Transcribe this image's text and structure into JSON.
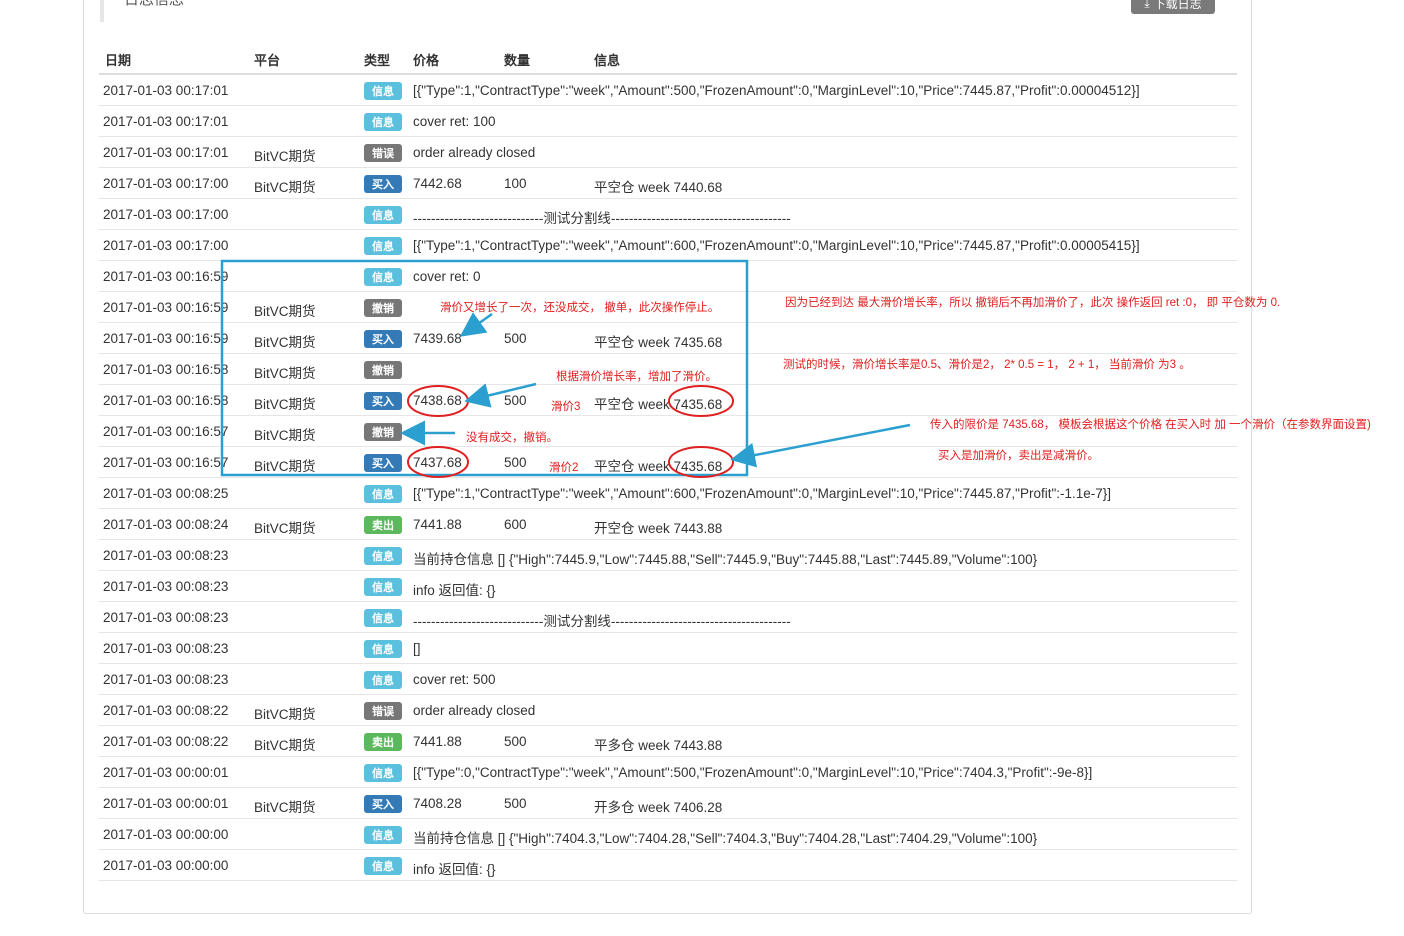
{
  "panel": {
    "title": "日志信息",
    "download_label": "下载日志"
  },
  "columns": {
    "date": "日期",
    "platform": "平台",
    "type": "类型",
    "price": "价格",
    "amount": "数量",
    "info": "信息"
  },
  "badges": {
    "info": "信息",
    "error": "错误",
    "buy": "买入",
    "sell": "卖出",
    "cancel": "撤销"
  },
  "rows": [
    {
      "date": "2017-01-03 00:17:01",
      "platform": "",
      "type": "info",
      "long": "[{\"Type\":1,\"ContractType\":\"week\",\"Amount\":500,\"FrozenAmount\":0,\"MarginLevel\":10,\"Price\":7445.87,\"Profit\":0.00004512}]"
    },
    {
      "date": "2017-01-03 00:17:01",
      "platform": "",
      "type": "info",
      "long": "cover ret: 100"
    },
    {
      "date": "2017-01-03 00:17:01",
      "platform": "BitVC期货",
      "type": "error",
      "long": "order already closed"
    },
    {
      "date": "2017-01-03 00:17:00",
      "platform": "BitVC期货",
      "type": "buy",
      "price": "7442.68",
      "amount": "100",
      "msg": "平空仓 week 7440.68"
    },
    {
      "date": "2017-01-03 00:17:00",
      "platform": "",
      "type": "info",
      "long": "-----------------------------测试分割线----------------------------------------"
    },
    {
      "date": "2017-01-03 00:17:00",
      "platform": "",
      "type": "info",
      "long": "[{\"Type\":1,\"ContractType\":\"week\",\"Amount\":600,\"FrozenAmount\":0,\"MarginLevel\":10,\"Price\":7445.87,\"Profit\":0.00005415}]"
    },
    {
      "date": "2017-01-03 00:16:59",
      "platform": "",
      "type": "info",
      "long": "cover ret: 0"
    },
    {
      "date": "2017-01-03 00:16:59",
      "platform": "BitVC期货",
      "type": "cancel",
      "long": ""
    },
    {
      "date": "2017-01-03 00:16:59",
      "platform": "BitVC期货",
      "type": "buy",
      "price": "7439.68",
      "amount": "500",
      "msg": "平空仓 week 7435.68"
    },
    {
      "date": "2017-01-03 00:16:58",
      "platform": "BitVC期货",
      "type": "cancel",
      "long": ""
    },
    {
      "date": "2017-01-03 00:16:58",
      "platform": "BitVC期货",
      "type": "buy",
      "price": "7438.68",
      "amount": "500",
      "msg": "平空仓 week 7435.68"
    },
    {
      "date": "2017-01-03 00:16:57",
      "platform": "BitVC期货",
      "type": "cancel",
      "long": ""
    },
    {
      "date": "2017-01-03 00:16:57",
      "platform": "BitVC期货",
      "type": "buy",
      "price": "7437.68",
      "amount": "500",
      "msg": "平空仓 week 7435.68"
    },
    {
      "date": "2017-01-03 00:08:25",
      "platform": "",
      "type": "info",
      "long": "[{\"Type\":1,\"ContractType\":\"week\",\"Amount\":600,\"FrozenAmount\":0,\"MarginLevel\":10,\"Price\":7445.87,\"Profit\":-1.1e-7}]"
    },
    {
      "date": "2017-01-03 00:08:24",
      "platform": "BitVC期货",
      "type": "sell",
      "price": "7441.88",
      "amount": "600",
      "msg": "开空仓 week 7443.88"
    },
    {
      "date": "2017-01-03 00:08:23",
      "platform": "",
      "type": "info",
      "long": "当前持仓信息 [] {\"High\":7445.9,\"Low\":7445.88,\"Sell\":7445.9,\"Buy\":7445.88,\"Last\":7445.89,\"Volume\":100}"
    },
    {
      "date": "2017-01-03 00:08:23",
      "platform": "",
      "type": "info",
      "long": "info 返回值: {}"
    },
    {
      "date": "2017-01-03 00:08:23",
      "platform": "",
      "type": "info",
      "long": "-----------------------------测试分割线----------------------------------------"
    },
    {
      "date": "2017-01-03 00:08:23",
      "platform": "",
      "type": "info",
      "long": "[]"
    },
    {
      "date": "2017-01-03 00:08:23",
      "platform": "",
      "type": "info",
      "long": "cover ret: 500"
    },
    {
      "date": "2017-01-03 00:08:22",
      "platform": "BitVC期货",
      "type": "error",
      "long": "order already closed"
    },
    {
      "date": "2017-01-03 00:08:22",
      "platform": "BitVC期货",
      "type": "sell",
      "price": "7441.88",
      "amount": "500",
      "msg": "平多仓 week 7443.88"
    },
    {
      "date": "2017-01-03 00:00:01",
      "platform": "",
      "type": "info",
      "long": "[{\"Type\":0,\"ContractType\":\"week\",\"Amount\":500,\"FrozenAmount\":0,\"MarginLevel\":10,\"Price\":7404.3,\"Profit\":-9e-8}]"
    },
    {
      "date": "2017-01-03 00:00:01",
      "platform": "BitVC期货",
      "type": "buy",
      "price": "7408.28",
      "amount": "500",
      "msg": "开多仓 week 7406.28"
    },
    {
      "date": "2017-01-03 00:00:00",
      "platform": "",
      "type": "info",
      "long": "当前持仓信息 [] {\"High\":7404.3,\"Low\":7404.28,\"Sell\":7404.3,\"Buy\":7404.28,\"Last\":7404.29,\"Volume\":100}"
    },
    {
      "date": "2017-01-03 00:00:00",
      "platform": "",
      "type": "info",
      "long": "info 返回值: {}"
    }
  ],
  "annotations": {
    "note_slippage_again": "滑价又增长了一次，还没成交， 撤单，此次操作停止。",
    "note_max_slippage": "因为已经到达 最大滑价增长率，所以 撤销后不再加滑价了，此次 操作返回 ret :0，  即 平仓数为 0.",
    "note_test_params": "测试的时候，滑价增长率是0.5、滑价是2，  2* 0.5 = 1，  2 + 1，  当前滑价 为3 。",
    "note_increase": "根据滑价增长率，增加了滑价。",
    "note_slip3": "滑价3",
    "note_not_filled": "没有成交，撤销。",
    "note_limit_price": "传入的限价是 7435.68， 模板会根据这个价格 在买入时 加 一个滑价（在参数界面设置)",
    "note_slip2": "滑价2",
    "note_buy_sell": "买入是加滑价，卖出是减滑价。",
    "accent_red": "#e02020",
    "accent_blue": "#2a9fd0"
  }
}
